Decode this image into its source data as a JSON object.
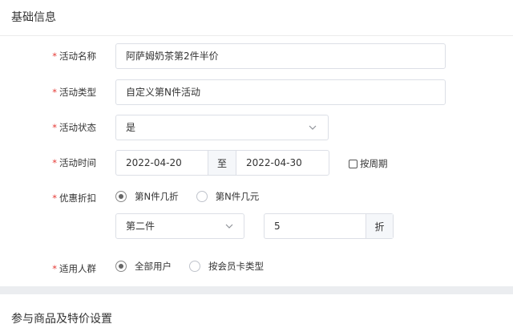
{
  "basic_info": {
    "title": "基础信息"
  },
  "form": {
    "required_mark": "*",
    "activity_name": {
      "label": "活动名称",
      "value": "阿萨姆奶茶第2件半价"
    },
    "activity_type": {
      "label": "活动类型",
      "value": "自定义第N件活动"
    },
    "activity_status": {
      "label": "活动状态",
      "value": "是",
      "icon": "chevron-down-icon"
    },
    "activity_time": {
      "label": "活动时间",
      "start": "2022-04-20",
      "separator": "至",
      "end": "2022-04-30",
      "periodic_checkbox": {
        "label": "按周期",
        "checked": false
      }
    },
    "discount": {
      "label": "优惠折扣",
      "options": [
        {
          "label": "第N件几折",
          "checked": true
        },
        {
          "label": "第N件几元",
          "checked": false
        }
      ],
      "item_select": {
        "value": "第二件",
        "icon": "chevron-down-icon"
      },
      "amount": {
        "value": "5",
        "suffix": "折"
      }
    },
    "audience": {
      "label": "适用人群",
      "options": [
        {
          "label": "全部用户",
          "checked": true
        },
        {
          "label": "按会员卡类型",
          "checked": false
        }
      ]
    }
  },
  "goods_section": {
    "title": "参与商品及特价设置"
  },
  "colors": {
    "required": "#e53935",
    "border": "#dcdfe6",
    "section_band": "#ebedf0",
    "addon_bg": "#f5f7fa"
  }
}
